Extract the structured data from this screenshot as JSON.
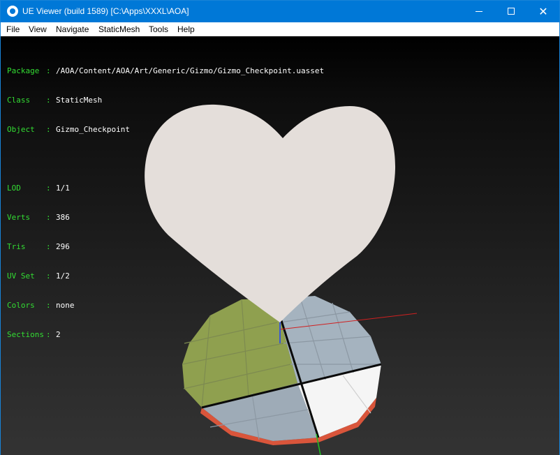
{
  "window": {
    "title": "UE Viewer (build 1589) [C:\\Apps\\XXXL\\AOA]",
    "accent": "#0078d7"
  },
  "menu": [
    "File",
    "View",
    "Navigate",
    "StaticMesh",
    "Tools",
    "Help"
  ],
  "info": {
    "package": {
      "label": "Package",
      "value": "/AOA/Content/AOA/Art/Generic/Gizmo/Gizmo_Checkpoint.uasset"
    },
    "class": {
      "label": "Class",
      "value": "StaticMesh"
    },
    "object": {
      "label": "Object",
      "value": "Gizmo_Checkpoint"
    },
    "lod": {
      "label": "LOD",
      "value": "1/1"
    },
    "verts": {
      "label": "Verts",
      "value": "386"
    },
    "tris": {
      "label": "Tris",
      "value": "296"
    },
    "uvset": {
      "label": "UV Set",
      "value": "1/2"
    },
    "colors": {
      "label": "Colors",
      "value": "none"
    },
    "sections": {
      "label": "Sections",
      "value": "2"
    },
    "separator": ":"
  },
  "colors": {
    "label_green": "#33dd33",
    "heart": "#e4deda",
    "tile_green": "#8fa04f",
    "tile_blue": "#a4b2be",
    "tile_white": "#f5f5f5",
    "rim_red": "#e0553a"
  }
}
